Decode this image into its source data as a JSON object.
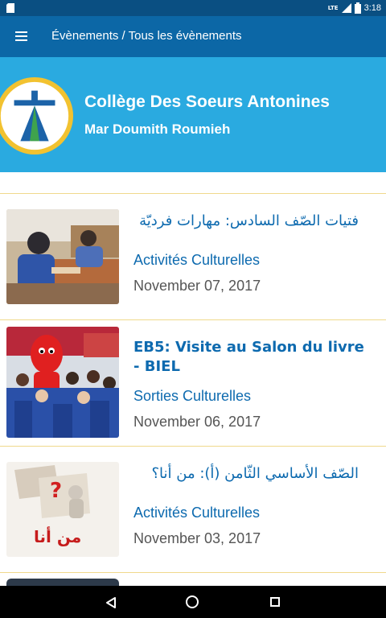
{
  "status_bar": {
    "network": "LTE",
    "time": "3:18"
  },
  "app_bar": {
    "title": "Évènements / Tous les évènements",
    "menu_icon": "hamburger-menu-icon"
  },
  "banner": {
    "line1": "Collège Des Soeurs Antonines",
    "line2": "Mar Doumith Roumieh",
    "background": "#2aaae0"
  },
  "events": [
    {
      "title": "فتيات الصّف السادس: مهارات فرديّة",
      "category": "Activités Culturelles",
      "date": "November 07, 2017"
    },
    {
      "title": "EB5: Visite au Salon du livre - BIEL",
      "category": "Sorties Culturelles",
      "date": "November 06, 2017"
    },
    {
      "title": "الصّف الأساسي الثّامن (أ): من أنا؟",
      "category": "Activités Culturelles",
      "date": "November 03, 2017"
    }
  ],
  "thumb3_text": "من أنا",
  "colors": {
    "app_bar": "#0c67a6",
    "status_bar": "#0a4f82",
    "accent_text": "#0d6aaf",
    "divider": "#f0d98c"
  }
}
